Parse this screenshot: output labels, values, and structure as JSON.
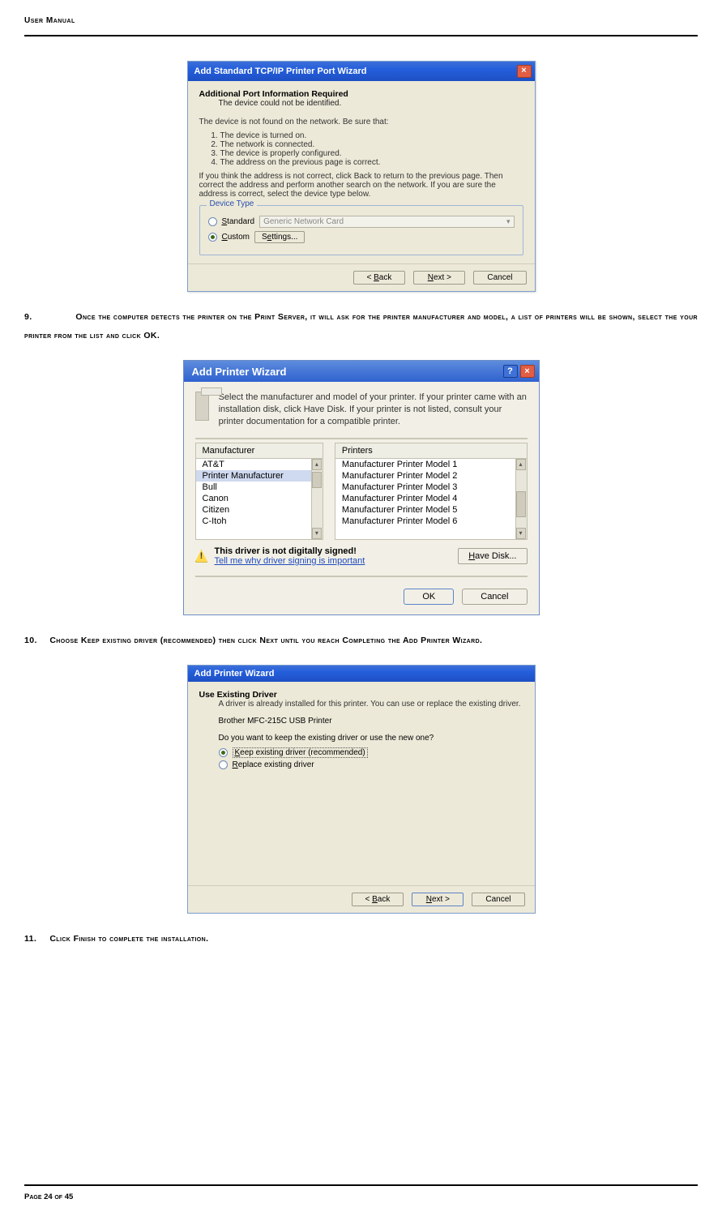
{
  "header": "User Manual",
  "dlg1": {
    "title": "Add Standard TCP/IP Printer Port Wizard",
    "h1": "Additional Port Information Required",
    "sub": "The device could not be identified.",
    "p1": "The device is not found on the network.  Be sure that:",
    "list": {
      "i1": "The device is turned on.",
      "i2": "The network is connected.",
      "i3": "The device is properly configured.",
      "i4": "The address on the previous page is correct."
    },
    "p2": "If you think the address is not correct, click Back to return to the previous page. Then correct the address and perform another search on the network. If you are sure the address is correct, select the device type below.",
    "legend": "Device Type",
    "radio1": "Standard",
    "combo": "Generic Network Card",
    "radio2": "Custom",
    "settings": "Settings...",
    "back": "< Back",
    "next": "Next >",
    "cancel": "Cancel"
  },
  "step9": {
    "num": "9.",
    "text_a": "Once the computer detects the printer on the Print Server, it will ask for the printer manufacturer and model, a list of printers will be shown, select the your printer from the list and click ",
    "text_b": "OK",
    "text_c": "."
  },
  "dlg2": {
    "title": "Add Printer Wizard",
    "desc": "Select the manufacturer and model of your printer. If your printer came with an installation disk, click Have Disk. If your printer is not listed, consult your printer documentation for a compatible printer.",
    "col1": "Manufacturer",
    "col2": "Printers",
    "m": {
      "i1": "AT&T",
      "i2": "Printer Manufacturer",
      "i3": "Bull",
      "i4": "Canon",
      "i5": "Citizen",
      "i6": "C-Itoh"
    },
    "p": {
      "i1": "Manufacturer Printer Model 1",
      "i2": "Manufacturer Printer Model 2",
      "i3": "Manufacturer Printer Model 3",
      "i4": "Manufacturer Printer Model 4",
      "i5": "Manufacturer Printer Model 5",
      "i6": "Manufacturer Printer Model 6"
    },
    "warn": "This driver is not digitally signed!",
    "link": "Tell me why driver signing is important",
    "havedisk": "Have Disk...",
    "ok": "OK",
    "cancel": "Cancel"
  },
  "step10": {
    "num": "10.",
    "a": "Choose ",
    "b": "Keep existing driver (recommended)",
    "c": " then click ",
    "d": "Next",
    "e": " until you reach ",
    "f": "Completing the Add Printer Wizard",
    "g": "."
  },
  "dlg3": {
    "title": "Add Printer Wizard",
    "h1": "Use Existing Driver",
    "sub": "A driver is already installed for this printer. You can use or replace the existing driver.",
    "pname": "Brother MFC-215C USB Printer",
    "q": "Do you want to keep the existing driver or use the new one?",
    "opt1": "Keep existing driver (recommended)",
    "opt2": "Replace existing driver",
    "back": "< Back",
    "next": "Next >",
    "cancel": "Cancel"
  },
  "step11": {
    "num": "11.",
    "a": "Click ",
    "b": "Finish",
    "c": " to complete the installation."
  },
  "footer": "Page 24 of 45"
}
